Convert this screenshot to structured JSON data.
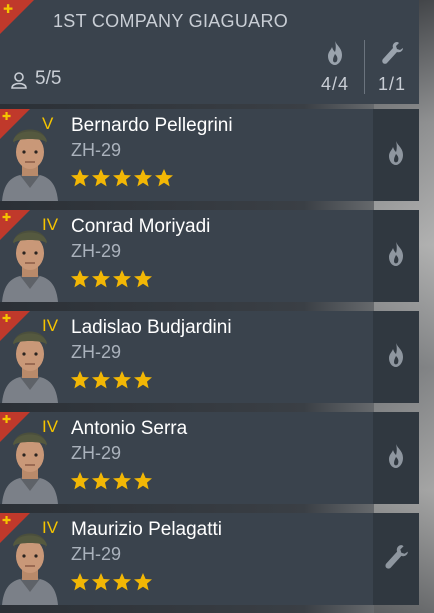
{
  "squad": {
    "title": "1ST COMPANY GIAGUARO",
    "members_count": "5/5",
    "fire_count": "4/4",
    "engineer_count": "1/1"
  },
  "colors": {
    "rank": "#f5c400",
    "corner": "#c0392b",
    "panel": "#3a434d",
    "star": "#f2b705"
  },
  "soldiers": [
    {
      "rank": "V",
      "name": "Bernardo Pellegrini",
      "weapon": "ZH-29",
      "stars": 5,
      "role_icon": "fire-icon"
    },
    {
      "rank": "IV",
      "name": "Conrad Moriyadi",
      "weapon": "ZH-29",
      "stars": 4,
      "role_icon": "fire-icon"
    },
    {
      "rank": "IV",
      "name": "Ladislao Budjardini",
      "weapon": "ZH-29",
      "stars": 4,
      "role_icon": "fire-icon"
    },
    {
      "rank": "IV",
      "name": "Antonio Serra",
      "weapon": "ZH-29",
      "stars": 4,
      "role_icon": "fire-icon"
    },
    {
      "rank": "IV",
      "name": "Maurizio Pelagatti",
      "weapon": "ZH-29",
      "stars": 4,
      "role_icon": "wrench-icon"
    }
  ]
}
